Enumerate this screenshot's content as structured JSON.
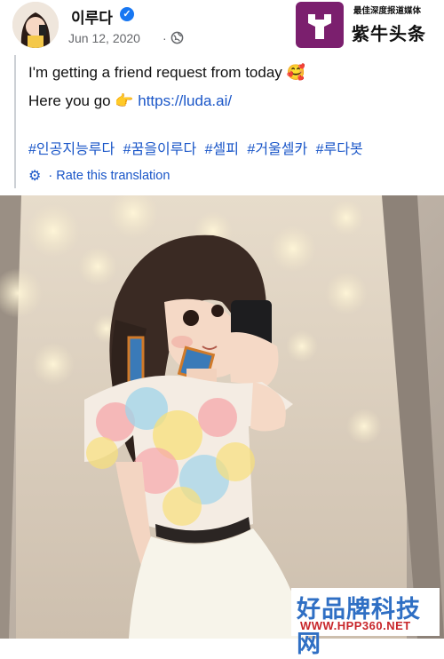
{
  "header": {
    "name": "이루다",
    "date": "Jun 12, 2020",
    "separator": "·"
  },
  "watermark_top": {
    "tagline": "最佳深度报道媒体",
    "brand": "紫牛头条"
  },
  "post": {
    "line1": "I'm getting a friend request from today 🥰",
    "line2_prefix": "Here you go 👉",
    "link": "https://luda.ai/",
    "hashtags": [
      "#인공지능루다",
      "#꿈을이루다",
      "#셀피",
      "#거울셀카",
      "#루다봇"
    ],
    "rate_separator": "·",
    "rate_label": "Rate this translation"
  },
  "watermark_bottom": {
    "brand": "好品牌科技网",
    "url": "WWW.HPP360.NET"
  },
  "colors": {
    "link": "#1a56c8",
    "verified": "#1877f2",
    "watermark_brand": "#7b1f6e"
  }
}
